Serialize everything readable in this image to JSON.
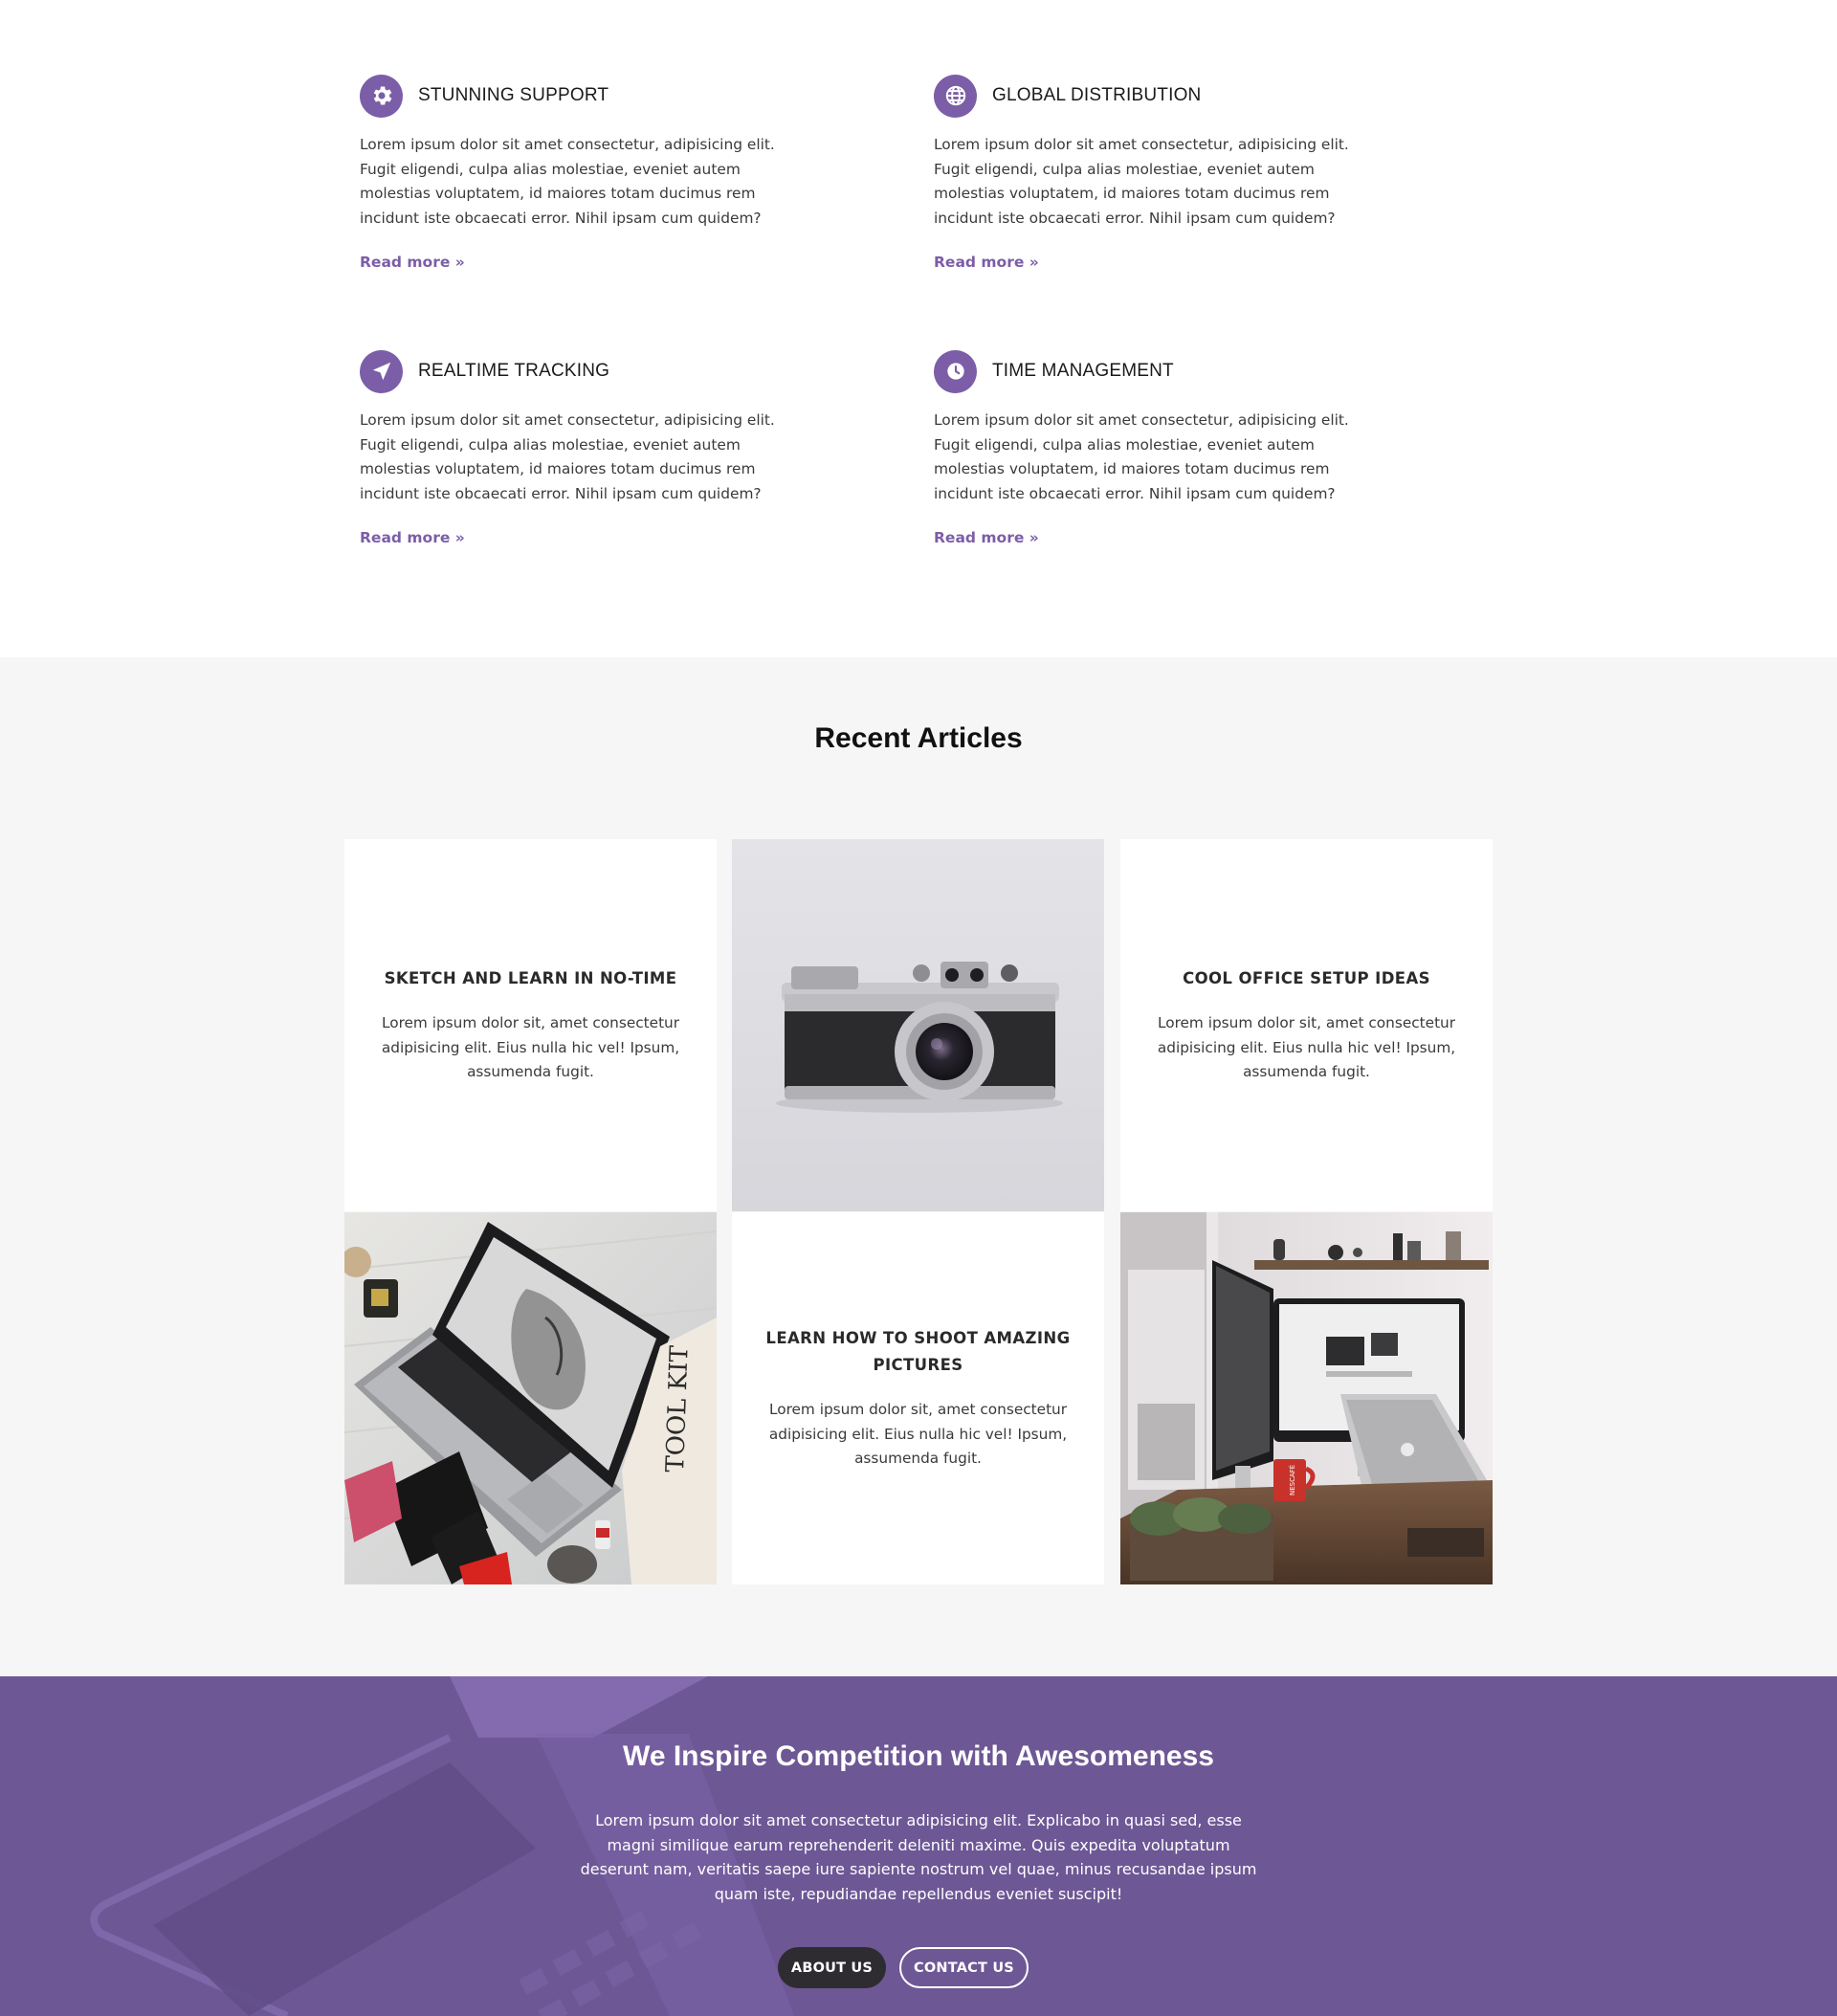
{
  "features": [
    {
      "icon": "gear-icon",
      "title": "STUNNING SUPPORT",
      "text": "Lorem ipsum dolor sit amet consectetur, adipisicing elit. Fugit eligendi, culpa alias molestiae, eveniet autem molestias voluptatem, id maiores totam ducimus rem incidunt iste obcaecati error. Nihil ipsam cum quidem?",
      "link": "Read more »"
    },
    {
      "icon": "globe-icon",
      "title": "GLOBAL DISTRIBUTION",
      "text": "Lorem ipsum dolor sit amet consectetur, adipisicing elit. Fugit eligendi, culpa alias molestiae, eveniet autem molestias voluptatem, id maiores totam ducimus rem incidunt iste obcaecati error. Nihil ipsam cum quidem?",
      "link": "Read more »"
    },
    {
      "icon": "location-arrow-icon",
      "title": "REALTIME TRACKING",
      "text": "Lorem ipsum dolor sit amet consectetur, adipisicing elit. Fugit eligendi, culpa alias molestiae, eveniet autem molestias voluptatem, id maiores totam ducimus rem incidunt iste obcaecati error. Nihil ipsam cum quidem?",
      "link": "Read more »"
    },
    {
      "icon": "clock-icon",
      "title": "TIME MANAGEMENT",
      "text": "Lorem ipsum dolor sit amet consectetur, adipisicing elit. Fugit eligendi, culpa alias molestiae, eveniet autem molestias voluptatem, id maiores totam ducimus rem incidunt iste obcaecati error. Nihil ipsam cum quidem?",
      "link": "Read more »"
    }
  ],
  "articles": {
    "heading": "Recent Articles",
    "cards": [
      {
        "title": "SKETCH AND LEARN IN NO-TIME",
        "text": "Lorem ipsum dolor sit, amet consectetur adipisicing elit. Eius nulla hic vel! Ipsum, assumenda fugit."
      },
      {
        "title": "COOL OFFICE SETUP IDEAS",
        "text": "Lorem ipsum dolor sit, amet consectetur adipisicing elit. Eius nulla hic vel! Ipsum, assumenda fugit."
      },
      {
        "title": "LEARN HOW TO SHOOT AMAZING PICTURES",
        "text": "Lorem ipsum dolor sit, amet consectetur adipisicing elit. Eius nulla hic vel! Ipsum, assumenda fugit."
      }
    ],
    "photos": {
      "camera": "camera-photo",
      "laptop": "laptop-photo",
      "desk": "desk-photo"
    },
    "photo_text": {
      "toolkit": "TOOL KIT",
      "mug": "NESCAFÉ"
    }
  },
  "cta": {
    "title": "We Inspire Competition with Awesomeness",
    "text": "Lorem ipsum dolor sit amet consectetur adipisicing elit. Explicabo in quasi sed, esse magni similique earum reprehenderit deleniti maxime. Quis expedita voluptatum deserunt nam, veritatis saepe iure sapiente nostrum vel quae, minus recusandae ipsum quam iste, repudiandae repellendus eveniet suscipit!",
    "about_label": "ABOUT US",
    "contact_label": "CONTACT US"
  },
  "colors": {
    "accent": "#7b5ea7",
    "cta_background": "#6d5795",
    "section_background": "#f6f6f7",
    "dark_button": "#2e2c30"
  }
}
